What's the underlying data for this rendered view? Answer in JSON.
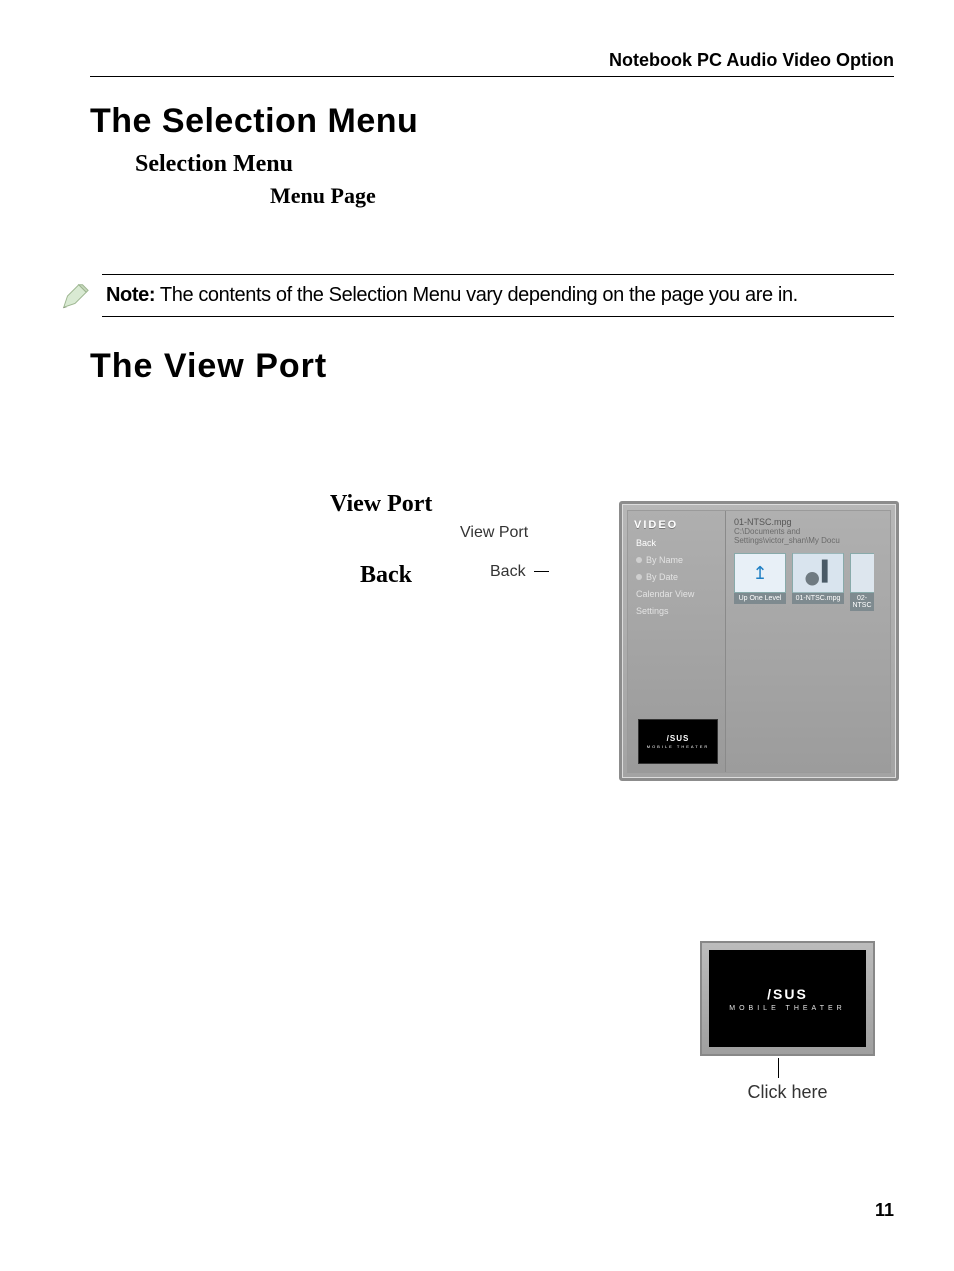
{
  "header": {
    "title": "Notebook PC Audio Video Option"
  },
  "section1": {
    "h1": "The Selection Menu",
    "h2": "Selection Menu",
    "h3": "Menu Page"
  },
  "note": {
    "prefix": "Note:",
    "text": " The contents of the Selection Menu vary depending on the page you are in."
  },
  "section2": {
    "h1": "The View Port",
    "callout_back": "Back",
    "h2_viewport": "View Port",
    "callout_viewport": "View Port",
    "h2_back": "Back"
  },
  "figure1": {
    "sidebar_title": "VIDEO",
    "items": [
      "Back",
      "By Name",
      "By Date",
      "Calendar View",
      "Settings"
    ],
    "file_name": "01-NTSC.mpg",
    "file_path": "C:\\Documents and Settings\\victor_shan\\My Docu",
    "thumbs": [
      {
        "label": "Up One Level",
        "type": "up"
      },
      {
        "label": "01-NTSC.mpg",
        "type": "img"
      },
      {
        "label": "02-NTSC",
        "type": "img"
      }
    ],
    "mini_logo": "/SUS",
    "mini_sub": "MOBILE THEATER"
  },
  "figure2": {
    "logo": "/SUS",
    "sub": "MOBILE THEATER",
    "label": "Click here"
  },
  "page_number": "11"
}
